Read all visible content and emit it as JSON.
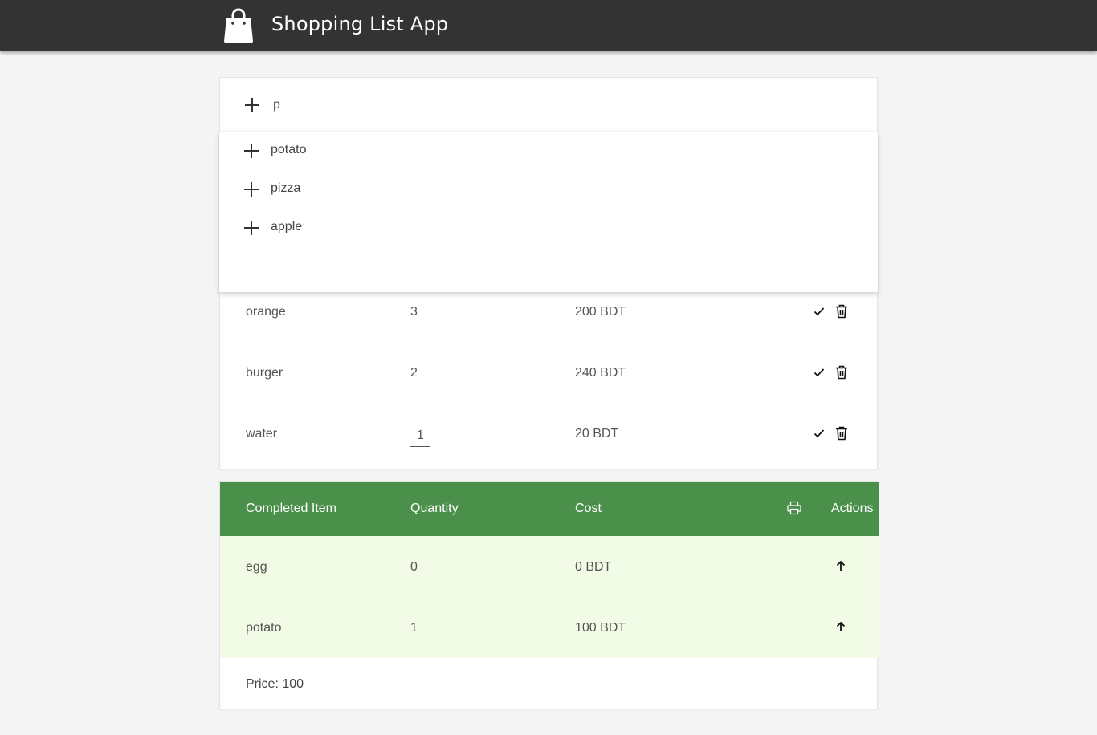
{
  "header": {
    "title": "Shopping List App"
  },
  "add_form": {
    "value": "p"
  },
  "suggestions": [
    "potato",
    "pizza",
    "apple"
  ],
  "shopping_list": [
    {
      "name": "orange",
      "quantity": "3",
      "cost": "200 BDT"
    },
    {
      "name": "burger",
      "quantity": "2",
      "cost": "240 BDT"
    },
    {
      "name": "water",
      "quantity": "1",
      "cost": "20 BDT"
    }
  ],
  "completed": {
    "headers": {
      "item": "Completed Item",
      "quantity": "Quantity",
      "cost": "Cost",
      "actions": "Actions"
    },
    "rows": [
      {
        "name": "egg",
        "quantity": "0",
        "cost": "0 BDT"
      },
      {
        "name": "potato",
        "quantity": "1",
        "cost": "100 BDT"
      }
    ],
    "price": "Price: 100"
  },
  "colors": {
    "topbar": "#333333",
    "completed_header": "#4a8f4a",
    "completed_row": "#f1fbe5",
    "background": "#f4f4f4"
  },
  "icons": [
    "shopping-bag-icon",
    "plus-icon",
    "check-icon",
    "trash-icon",
    "print-icon",
    "arrow-up-icon"
  ]
}
